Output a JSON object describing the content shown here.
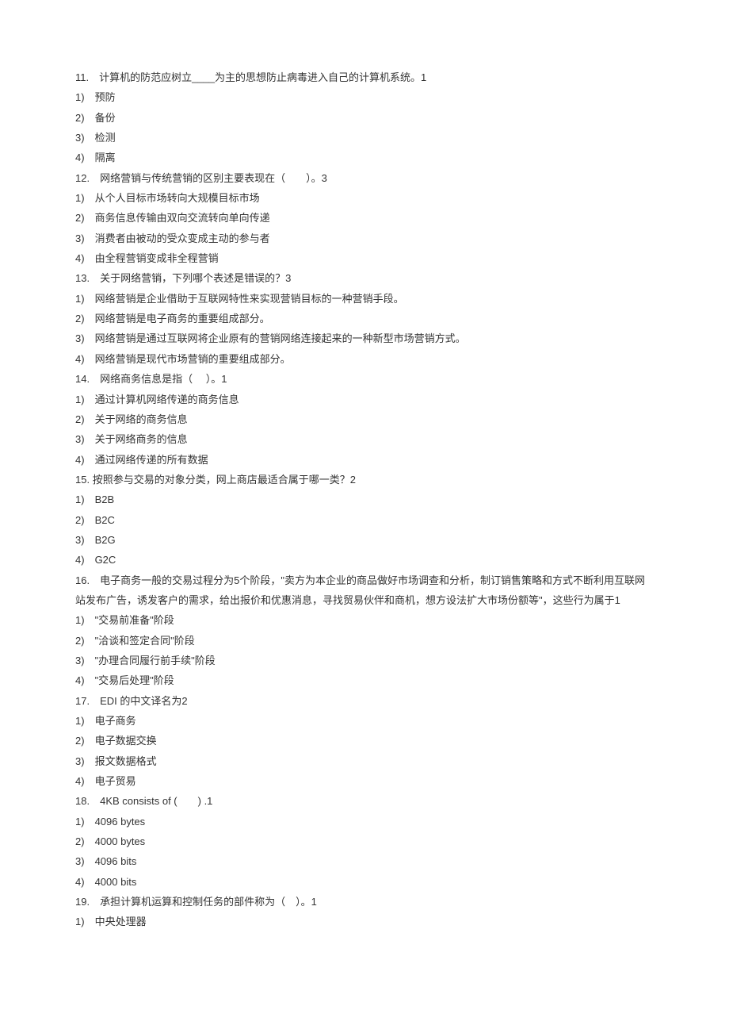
{
  "questions": [
    {
      "num": "11.",
      "text": "计算机的防范应树立____为主的思想防止病毒进入自己的计算机系统。1",
      "options": [
        "预防",
        "备份",
        "检测",
        "隔离"
      ]
    },
    {
      "num": "12.",
      "text": "网络营销与传统营销的区别主要表现在（　　）。3",
      "options": [
        "从个人目标市场转向大规模目标市场",
        "商务信息传输由双向交流转向单向传递",
        "消费者由被动的受众变成主动的参与者",
        "由全程营销变成非全程营销"
      ]
    },
    {
      "num": "13.",
      "text": "关于网络营销，下列哪个表述是错误的？3",
      "options": [
        "网络营销是企业借助于互联网特性来实现营销目标的一种营销手段。",
        "网络营销是电子商务的重要组成部分。",
        "网络营销是通过互联网将企业原有的营销网络连接起来的一种新型市场营销方式。",
        "网络营销是现代市场营销的重要组成部分。"
      ]
    },
    {
      "num": "14.",
      "text": "网络商务信息是指（　 ）。1",
      "options": [
        "通过计算机网络传递的商务信息",
        "关于网络的商务信息",
        "关于网络商务的信息",
        "通过网络传递的所有数据"
      ]
    },
    {
      "num": "15.",
      "text": "按照参与交易的对象分类，网上商店最适合属于哪一类？2",
      "options": [
        "B2B",
        "B2C",
        "B2G",
        "G2C"
      ]
    },
    {
      "num": "16.",
      "text": "电子商务一般的交易过程分为5个阶段，\"卖方为本企业的商品做好市场调查和分析，制订销售策略和方式不断利用互联网站发布广告，诱发客户的需求，给出报价和优惠消息，寻找贸易伙伴和商机，想方设法扩大市场份额等\"，这些行为属于1",
      "options": [
        "\"交易前准备\"阶段",
        "\"洽谈和签定合同\"阶段",
        "\"办理合同履行前手续\"阶段",
        "\"交易后处理\"阶段"
      ]
    },
    {
      "num": "17.",
      "text": "EDI 的中文译名为2",
      "options": [
        "电子商务",
        "电子数据交换",
        "报文数据格式",
        "电子贸易"
      ]
    },
    {
      "num": "18.",
      "text": "4KB consists of (　　) .1",
      "options": [
        "4096 bytes",
        "4000 bytes",
        "4096 bits",
        "4000 bits"
      ]
    },
    {
      "num": "19.",
      "text": "承担计算机运算和控制任务的部件称为（　）。1",
      "options": [
        "中央处理器"
      ]
    }
  ]
}
